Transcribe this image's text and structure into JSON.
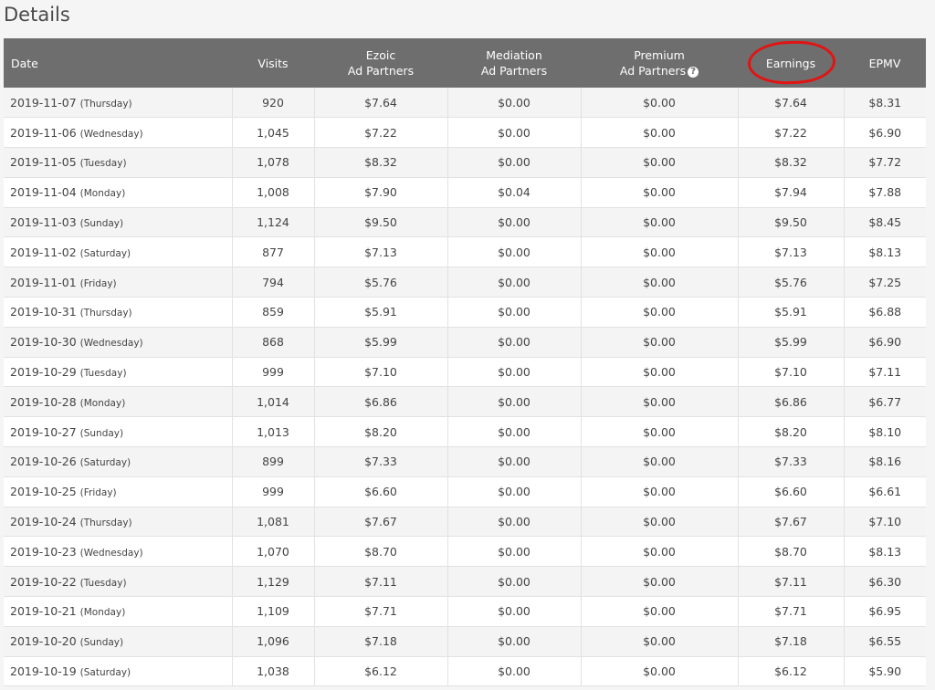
{
  "section_title": "Details",
  "columns": {
    "date": "Date",
    "visits": "Visits",
    "ezoic_line1": "Ezoic",
    "ezoic_line2": "Ad Partners",
    "mediation_line1": "Mediation",
    "mediation_line2": "Ad Partners",
    "premium_line1": "Premium",
    "premium_line2": "Ad Partners",
    "premium_help_icon": "question-circle-icon",
    "earnings": "Earnings",
    "epmv": "EPMV"
  },
  "annotation_color": "#e11414",
  "rows": [
    {
      "date": "2019-11-07",
      "dow": "(Thursday)",
      "visits": "920",
      "ezoic": "$7.64",
      "mediation": "$0.00",
      "premium": "$0.00",
      "earnings": "$7.64",
      "epmv": "$8.31"
    },
    {
      "date": "2019-11-06",
      "dow": "(Wednesday)",
      "visits": "1,045",
      "ezoic": "$7.22",
      "mediation": "$0.00",
      "premium": "$0.00",
      "earnings": "$7.22",
      "epmv": "$6.90"
    },
    {
      "date": "2019-11-05",
      "dow": "(Tuesday)",
      "visits": "1,078",
      "ezoic": "$8.32",
      "mediation": "$0.00",
      "premium": "$0.00",
      "earnings": "$8.32",
      "epmv": "$7.72"
    },
    {
      "date": "2019-11-04",
      "dow": "(Monday)",
      "visits": "1,008",
      "ezoic": "$7.90",
      "mediation": "$0.04",
      "premium": "$0.00",
      "earnings": "$7.94",
      "epmv": "$7.88"
    },
    {
      "date": "2019-11-03",
      "dow": "(Sunday)",
      "visits": "1,124",
      "ezoic": "$9.50",
      "mediation": "$0.00",
      "premium": "$0.00",
      "earnings": "$9.50",
      "epmv": "$8.45"
    },
    {
      "date": "2019-11-02",
      "dow": "(Saturday)",
      "visits": "877",
      "ezoic": "$7.13",
      "mediation": "$0.00",
      "premium": "$0.00",
      "earnings": "$7.13",
      "epmv": "$8.13"
    },
    {
      "date": "2019-11-01",
      "dow": "(Friday)",
      "visits": "794",
      "ezoic": "$5.76",
      "mediation": "$0.00",
      "premium": "$0.00",
      "earnings": "$5.76",
      "epmv": "$7.25"
    },
    {
      "date": "2019-10-31",
      "dow": "(Thursday)",
      "visits": "859",
      "ezoic": "$5.91",
      "mediation": "$0.00",
      "premium": "$0.00",
      "earnings": "$5.91",
      "epmv": "$6.88"
    },
    {
      "date": "2019-10-30",
      "dow": "(Wednesday)",
      "visits": "868",
      "ezoic": "$5.99",
      "mediation": "$0.00",
      "premium": "$0.00",
      "earnings": "$5.99",
      "epmv": "$6.90"
    },
    {
      "date": "2019-10-29",
      "dow": "(Tuesday)",
      "visits": "999",
      "ezoic": "$7.10",
      "mediation": "$0.00",
      "premium": "$0.00",
      "earnings": "$7.10",
      "epmv": "$7.11"
    },
    {
      "date": "2019-10-28",
      "dow": "(Monday)",
      "visits": "1,014",
      "ezoic": "$6.86",
      "mediation": "$0.00",
      "premium": "$0.00",
      "earnings": "$6.86",
      "epmv": "$6.77"
    },
    {
      "date": "2019-10-27",
      "dow": "(Sunday)",
      "visits": "1,013",
      "ezoic": "$8.20",
      "mediation": "$0.00",
      "premium": "$0.00",
      "earnings": "$8.20",
      "epmv": "$8.10"
    },
    {
      "date": "2019-10-26",
      "dow": "(Saturday)",
      "visits": "899",
      "ezoic": "$7.33",
      "mediation": "$0.00",
      "premium": "$0.00",
      "earnings": "$7.33",
      "epmv": "$8.16"
    },
    {
      "date": "2019-10-25",
      "dow": "(Friday)",
      "visits": "999",
      "ezoic": "$6.60",
      "mediation": "$0.00",
      "premium": "$0.00",
      "earnings": "$6.60",
      "epmv": "$6.61"
    },
    {
      "date": "2019-10-24",
      "dow": "(Thursday)",
      "visits": "1,081",
      "ezoic": "$7.67",
      "mediation": "$0.00",
      "premium": "$0.00",
      "earnings": "$7.67",
      "epmv": "$7.10"
    },
    {
      "date": "2019-10-23",
      "dow": "(Wednesday)",
      "visits": "1,070",
      "ezoic": "$8.70",
      "mediation": "$0.00",
      "premium": "$0.00",
      "earnings": "$8.70",
      "epmv": "$8.13"
    },
    {
      "date": "2019-10-22",
      "dow": "(Tuesday)",
      "visits": "1,129",
      "ezoic": "$7.11",
      "mediation": "$0.00",
      "premium": "$0.00",
      "earnings": "$7.11",
      "epmv": "$6.30"
    },
    {
      "date": "2019-10-21",
      "dow": "(Monday)",
      "visits": "1,109",
      "ezoic": "$7.71",
      "mediation": "$0.00",
      "premium": "$0.00",
      "earnings": "$7.71",
      "epmv": "$6.95"
    },
    {
      "date": "2019-10-20",
      "dow": "(Sunday)",
      "visits": "1,096",
      "ezoic": "$7.18",
      "mediation": "$0.00",
      "premium": "$0.00",
      "earnings": "$7.18",
      "epmv": "$6.55"
    },
    {
      "date": "2019-10-19",
      "dow": "(Saturday)",
      "visits": "1,038",
      "ezoic": "$6.12",
      "mediation": "$0.00",
      "premium": "$0.00",
      "earnings": "$6.12",
      "epmv": "$5.90"
    }
  ]
}
